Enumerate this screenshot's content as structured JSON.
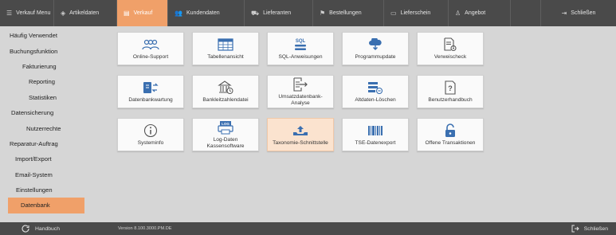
{
  "topnav": {
    "items": [
      {
        "label": "Verkauf Menu",
        "icon": "list-icon"
      },
      {
        "label": "Artikeldaten",
        "icon": "tag-icon"
      },
      {
        "label": "Verkauf",
        "icon": "cash-icon",
        "active": true
      },
      {
        "label": "Kundendaten",
        "icon": "people-icon"
      },
      {
        "label": "Lieferanten",
        "icon": "truck-icon"
      },
      {
        "label": "Bestellungen",
        "icon": "cart-icon"
      },
      {
        "label": "Lieferschein",
        "icon": "document-icon"
      },
      {
        "label": "Angebot",
        "icon": "person-icon"
      }
    ],
    "close_label": "Schließen"
  },
  "sidebar": {
    "items": [
      {
        "label": "Häufig Verwendet"
      },
      {
        "label": "Buchungsfunktion"
      },
      {
        "label": "Fakturierung"
      },
      {
        "label": "Reporting"
      },
      {
        "label": "Statistiken"
      },
      {
        "label": "Datensicherung"
      },
      {
        "label": "Nutzerrechte"
      },
      {
        "label": "Reparatur-Auftrag"
      },
      {
        "label": "Import/Export"
      },
      {
        "label": "Email-System"
      },
      {
        "label": "Einstellungen"
      },
      {
        "label": "Datenbank",
        "active": true
      }
    ]
  },
  "tiles": [
    {
      "label": "Online-Support",
      "icon": "people-group-icon"
    },
    {
      "label": "Tabellenansicht",
      "icon": "table-icon"
    },
    {
      "label": "SQL-Anweisungen",
      "icon": "sql-icon",
      "icon_text": "SQL"
    },
    {
      "label": "Programmupdate",
      "icon": "cloud-download-icon"
    },
    {
      "label": "Verweischeck",
      "icon": "document-gear-icon"
    },
    {
      "label": "Datenbankwartung",
      "icon": "database-arrows-icon"
    },
    {
      "label": "Bankleitzahlendatei",
      "icon": "bank-icon"
    },
    {
      "label": "Umsatzdatenbank-Analyse",
      "icon": "document-export-icon"
    },
    {
      "label": "Altdaten-Löschen",
      "icon": "list-delete-icon"
    },
    {
      "label": "Benutzerhandbuch",
      "icon": "help-document-icon"
    },
    {
      "label": "Systeminfo",
      "icon": "info-icon"
    },
    {
      "label": "Log-Daten Kassensoftware",
      "icon": "log-printer-icon",
      "icon_text": "LOG"
    },
    {
      "label": "Taxonomie-Schnittstelle",
      "icon": "upload-tray-icon",
      "active": true
    },
    {
      "label": "TSE-Datenexport",
      "icon": "barcode-icon"
    },
    {
      "label": "Offene Transaktionen",
      "icon": "lock-open-icon"
    }
  ],
  "bottombar": {
    "handbook_label": "Handbuch",
    "version": "Version 8.100.3000.PM.DE",
    "close_label": "Schließen"
  },
  "colors": {
    "accent": "#f0a069",
    "bar": "#4a4a4a",
    "background": "#d6d6d6",
    "icon_blue": "#3a6fb0"
  }
}
